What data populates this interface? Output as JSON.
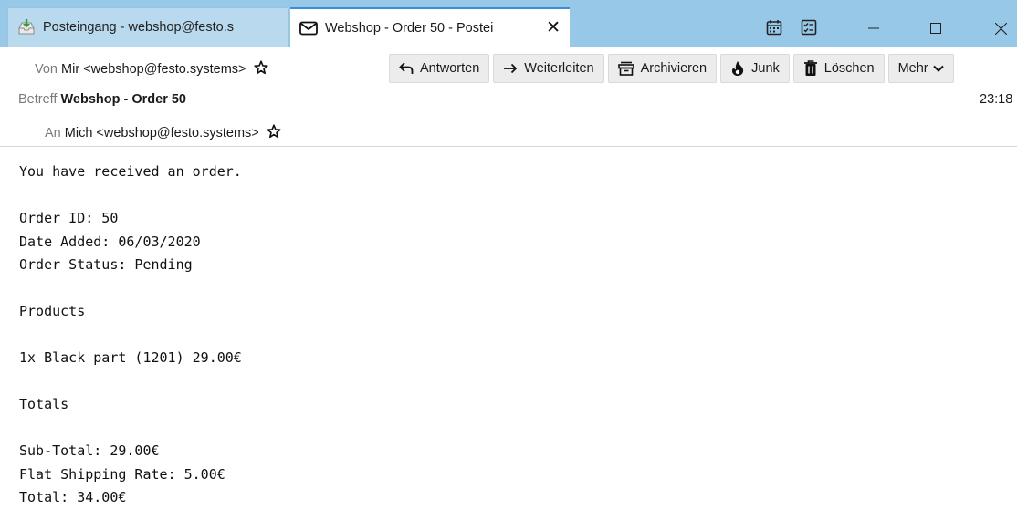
{
  "tabs": [
    {
      "label": "Posteingang - webshop@festo.s"
    },
    {
      "label": "Webshop - Order 50 - Postei"
    }
  ],
  "header": {
    "from_label": "Von",
    "from_value": "Mir <webshop@festo.systems>",
    "subject_label": "Betreff",
    "subject_value": "Webshop - Order 50",
    "to_label": "An",
    "to_value": "Mich <webshop@festo.systems>",
    "time": "23:18"
  },
  "toolbar": {
    "reply": "Antworten",
    "forward": "Weiterleiten",
    "archive": "Archivieren",
    "junk": "Junk",
    "delete": "Löschen",
    "more": "Mehr"
  },
  "body": {
    "intro": "You have received an order.",
    "order_id": "Order ID: 50",
    "date_added": "Date Added: 06/03/2020",
    "order_status": "Order Status: Pending",
    "products_heading": "Products",
    "product_line": "1x Black part (1201) 29.00€",
    "totals_heading": "Totals",
    "subtotal": "Sub-Total: 29.00€",
    "shipping": "Flat Shipping Rate: 5.00€",
    "total": "Total: 34.00€"
  },
  "colors": {
    "tabbar_bg": "#98c8e8",
    "active_tab_accent": "#3c8fd6",
    "button_bg": "#ececec"
  },
  "icons": [
    "inbox-download-icon",
    "envelope-icon",
    "calendar-icon",
    "tasks-icon",
    "minimize-icon",
    "maximize-icon",
    "close-window-icon",
    "reply-icon",
    "forward-icon",
    "archive-icon",
    "junk-flame-icon",
    "trash-icon",
    "chevron-down-icon",
    "star-icon"
  ]
}
